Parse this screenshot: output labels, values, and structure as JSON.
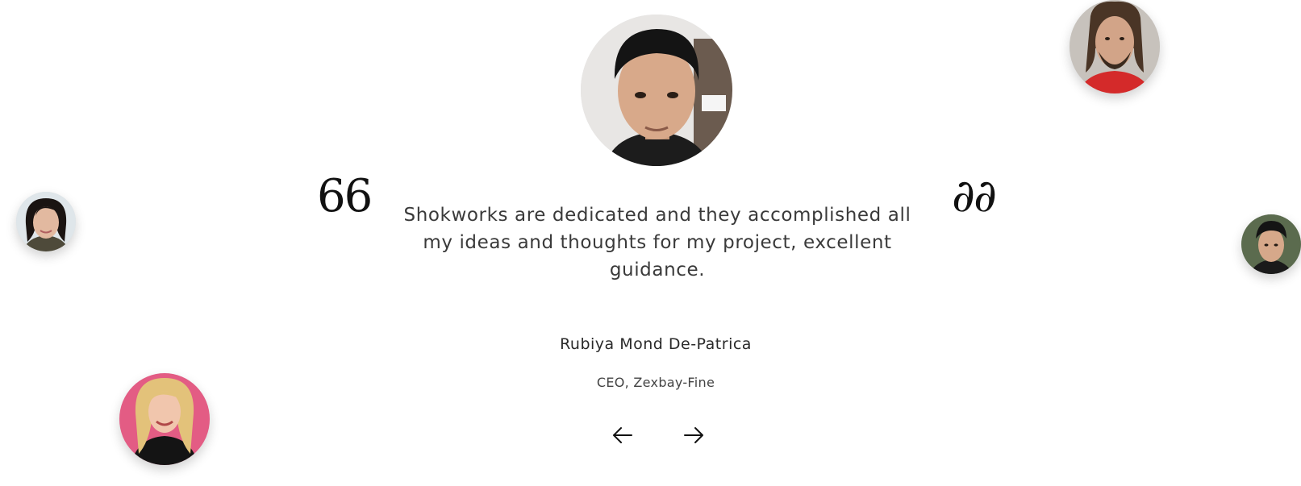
{
  "testimonial": {
    "quote": "Shokworks are dedicated and they accomplished all my ideas and thoughts for my project, excellent guidance.",
    "author_name": "Rubiya Mond De-Patrica",
    "author_title": "CEO, Zexbay-Fine",
    "open_quote_glyph": "66",
    "close_quote_glyph": "∂∂"
  },
  "navigation": {
    "prev_icon": "arrow-left-icon",
    "next_icon": "arrow-right-icon"
  },
  "avatars": [
    {
      "role": "active-author",
      "icon": "avatar-main"
    },
    {
      "role": "other",
      "icon": "avatar-top-right"
    },
    {
      "role": "other",
      "icon": "avatar-left"
    },
    {
      "role": "other",
      "icon": "avatar-right"
    },
    {
      "role": "other",
      "icon": "avatar-bottom-left"
    }
  ],
  "colors": {
    "background": "#ffffff",
    "text": "#3a3a3a",
    "quote_mark": "#111111"
  }
}
